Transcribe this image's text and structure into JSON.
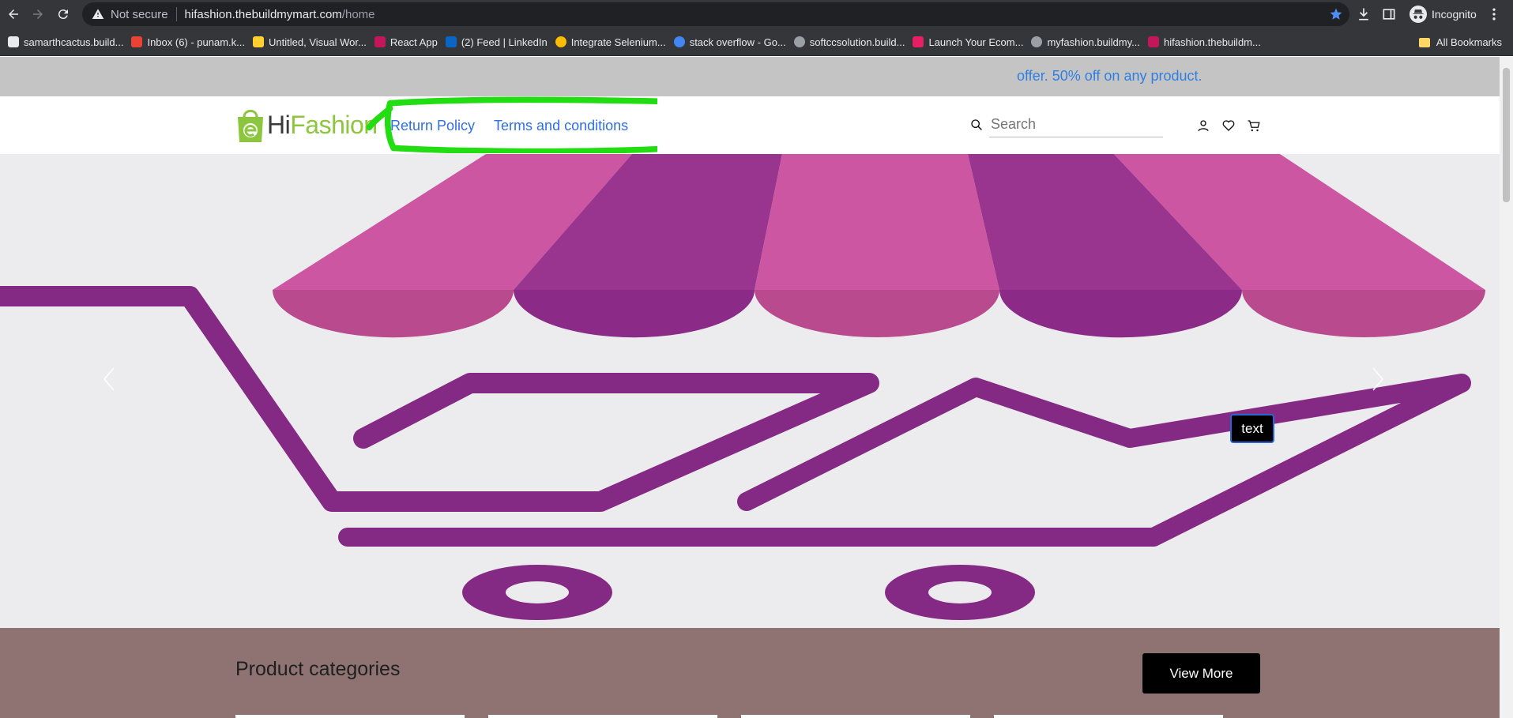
{
  "browser": {
    "address_security": "Not secure",
    "url_host": "hifashion.thebuildmymart.com",
    "url_path": "/home",
    "profile_label": "Incognito",
    "bookmarks": [
      {
        "label": "samarthcactus.build...",
        "icon": "site-icon",
        "color": "#e8eaed"
      },
      {
        "label": "Inbox (6) - punam.k...",
        "icon": "gmail-icon",
        "color": "#ea4335"
      },
      {
        "label": "Untitled, Visual Wor...",
        "icon": "miro-icon",
        "color": "#ffd02f"
      },
      {
        "label": "React App",
        "icon": "shop-icon",
        "color": "#c2185b"
      },
      {
        "label": "(2) Feed | LinkedIn",
        "icon": "linkedin-icon",
        "color": "#0a66c2"
      },
      {
        "label": "Integrate Selenium...",
        "icon": "chrome-icon",
        "color": "#fbbc04"
      },
      {
        "label": "stack overflow - Go...",
        "icon": "google-icon",
        "color": "#4285f4"
      },
      {
        "label": "softccsolution.build...",
        "icon": "globe-icon",
        "color": "#9aa0a6"
      },
      {
        "label": "Launch Your Ecom...",
        "icon": "store-icon",
        "color": "#e91e63"
      },
      {
        "label": "myfashion.buildmy...",
        "icon": "globe-icon",
        "color": "#9aa0a6"
      },
      {
        "label": "hifashion.thebuildm...",
        "icon": "shop-icon",
        "color": "#c2185b"
      }
    ],
    "all_bookmarks": "All Bookmarks"
  },
  "page": {
    "offer_text": "offer. 50% off on any product.",
    "logo_hi": "Hi",
    "logo_fashion": "Fashion",
    "nav": {
      "return_policy": "Return Policy",
      "terms": "Terms and conditions"
    },
    "search_placeholder": "Search",
    "hero_tag": "text",
    "categories_title": "Product categories",
    "view_more": "View More"
  },
  "colors": {
    "accent_link": "#2f6fe0",
    "logo_green": "#8cc63f",
    "highlight_green": "#22dd11",
    "awning_pink": "#cc56a1",
    "cart_purple": "#852a84",
    "category_bg": "#8f7373"
  }
}
